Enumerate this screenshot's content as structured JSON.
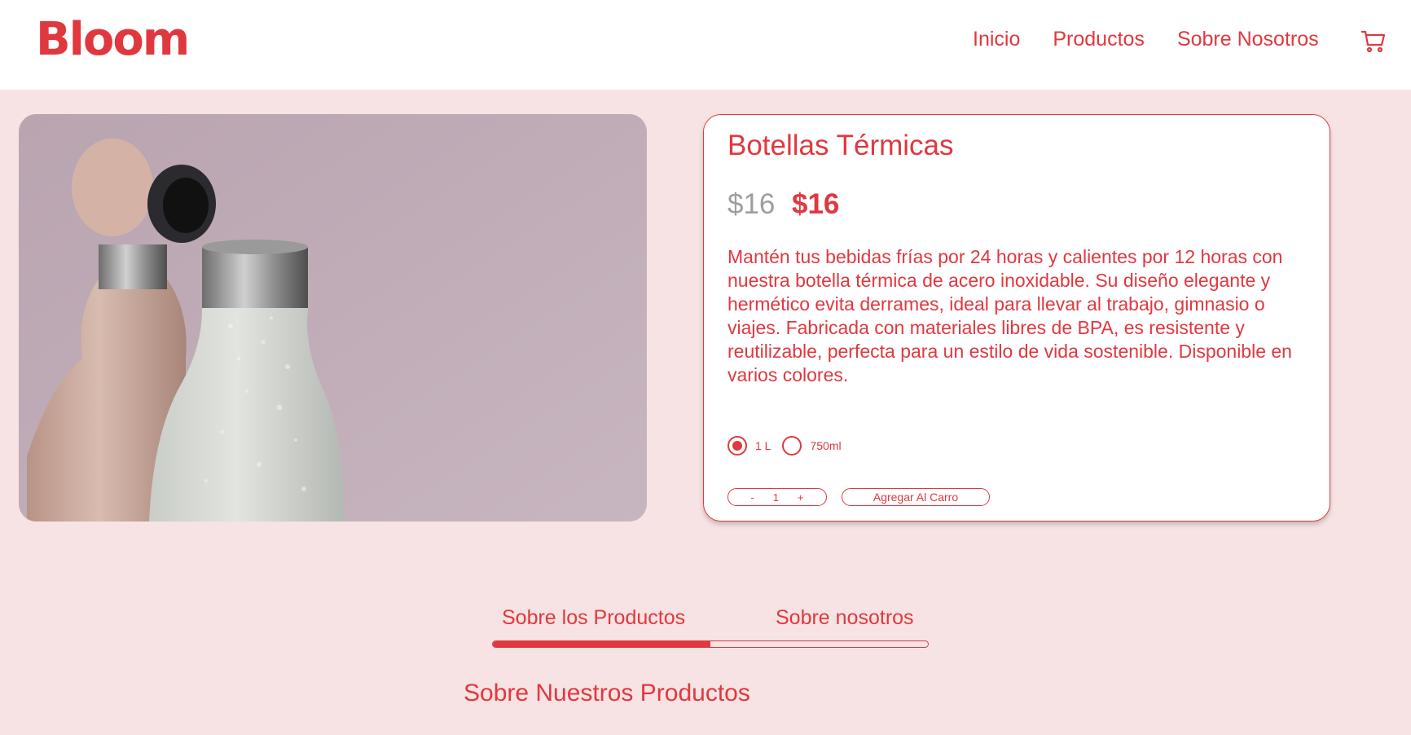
{
  "brand": {
    "logo": "Bloom"
  },
  "nav": {
    "items": [
      {
        "label": "Inicio"
      },
      {
        "label": "Productos"
      },
      {
        "label": "Sobre Nosotros"
      }
    ],
    "cart_icon": "shopping-cart-icon"
  },
  "product": {
    "title": "Botellas Térmicas",
    "price_old": "$16",
    "price_new": "$16",
    "description": "Mantén tus bebidas frías por 24 horas y calientes por 12 horas con nuestra botella térmica de acero inoxidable. Su diseño elegante y hermético evita derrames, ideal para llevar al trabajo, gimnasio o viajes. Fabricada con materiales libres de BPA, es resistente y reutilizable, perfecta para un estilo de vida sostenible. Disponible en varios colores.",
    "options": [
      {
        "label": "1 L",
        "selected": true
      },
      {
        "label": "750ml",
        "selected": false
      }
    ],
    "quantity": {
      "minus": "-",
      "value": "1",
      "plus": "+"
    },
    "add_to_cart_label": "Agregar Al Carro"
  },
  "tabs": {
    "items": [
      {
        "label": "Sobre los Productos",
        "active": true
      },
      {
        "label": "Sobre nosotros",
        "active": false
      }
    ],
    "progress": 0.5
  },
  "section": {
    "heading": "Sobre Nuestros Productos"
  },
  "colors": {
    "accent": "#e0383f",
    "background": "#f7e3e3",
    "card": "#ffffff",
    "muted_price": "#9e9e9e"
  }
}
